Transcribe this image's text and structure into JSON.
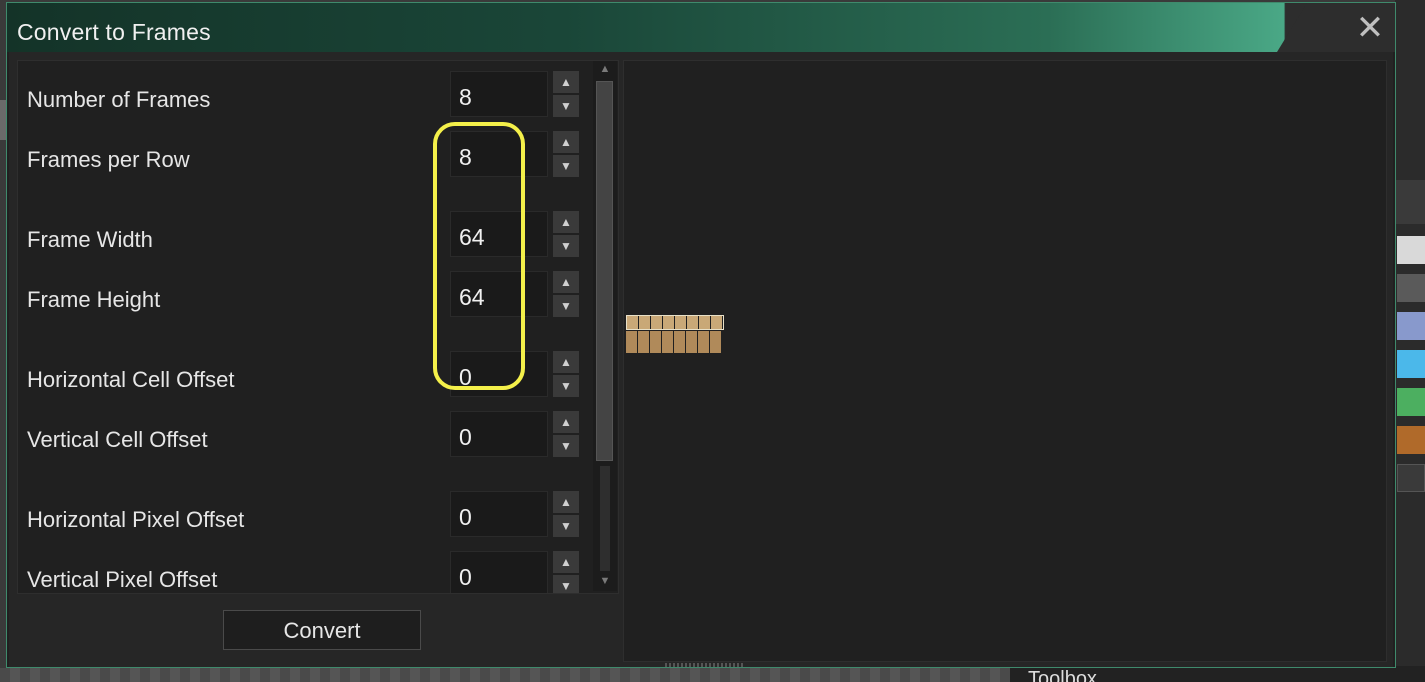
{
  "dialog": {
    "title": "Convert to Frames",
    "close_icon": "close-icon"
  },
  "fields": [
    {
      "label": "Number of Frames",
      "value": "8"
    },
    {
      "label": "Frames per Row",
      "value": "8"
    },
    {
      "label": "Frame Width",
      "value": "64"
    },
    {
      "label": "Frame Height",
      "value": "64"
    },
    {
      "label": "Horizontal Cell Offset",
      "value": "0"
    },
    {
      "label": "Vertical Cell Offset",
      "value": "0"
    },
    {
      "label": "Horizontal Pixel Offset",
      "value": "0"
    },
    {
      "label": "Vertical Pixel Offset",
      "value": "0"
    }
  ],
  "buttons": {
    "convert": "Convert"
  },
  "background": {
    "toolbox_label": "Toolbox"
  },
  "colors": {
    "highlight": "#f4f04a",
    "title_gradient_start": "#143328",
    "title_gradient_end": "#4aa886",
    "swatches": [
      "#d9d9d9",
      "#5a5a5a",
      "#8899cc",
      "#4bb8ea",
      "#4caf60",
      "#b06a2a",
      "#3a3a3a"
    ]
  }
}
